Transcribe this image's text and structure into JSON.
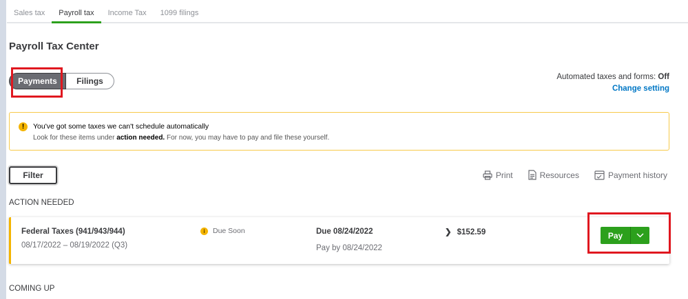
{
  "tabs": [
    {
      "label": "Sales tax"
    },
    {
      "label": "Payroll tax"
    },
    {
      "label": "Income Tax"
    },
    {
      "label": "1099 filings"
    }
  ],
  "page_title": "Payroll Tax Center",
  "segment": {
    "payments": "Payments",
    "filings": "Filings"
  },
  "automated": {
    "label": "Automated taxes and forms:",
    "value": "Off",
    "change": "Change setting"
  },
  "alert": {
    "title": "You've got some taxes we can't schedule automatically",
    "pre": "Look for these items under ",
    "bold": "action needed.",
    "post": " For now, you may have to pay and file these yourself."
  },
  "toolbar": {
    "filter": "Filter",
    "print": "Print",
    "resources": "Resources",
    "history": "Payment history"
  },
  "sections": {
    "action": "ACTION NEEDED",
    "coming": "COMING UP"
  },
  "item": {
    "name": "Federal Taxes (941/943/944)",
    "period": "08/17/2022 – 08/19/2022 (Q3)",
    "status": "Due Soon",
    "due": "Due 08/24/2022",
    "payby": "Pay by 08/24/2022",
    "amount": "$152.59",
    "pay": "Pay"
  },
  "colors": {
    "accent": "#2ca01c",
    "warning": "#f4b400",
    "link": "#0077c5",
    "annotation": "#e0171f"
  }
}
